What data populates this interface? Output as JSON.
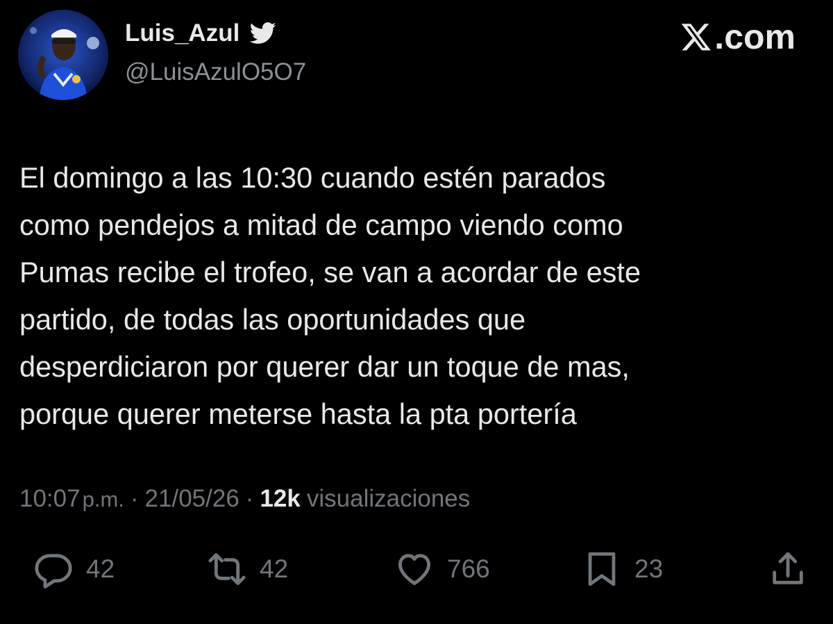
{
  "author": {
    "display_name": "Luis_Azul",
    "handle": "@LuisAzulO5O7",
    "verified_icon": "twitter-bird-icon",
    "avatar": "profile-photo-avatar"
  },
  "brand": {
    "label": ".com",
    "logo_icon": "x-logo-icon"
  },
  "tweet": {
    "lines": [
      "El domingo a las 10:30 cuando estén parados",
      "como pendejos a mitad de campo viendo como",
      "Pumas recibe el trofeo, se van a acordar de este",
      "partido, de todas las oportunidades que",
      "desperdiciaron por querer dar un toque de mas,",
      "porque querer meterse hasta la pta portería"
    ]
  },
  "meta": {
    "time": "10:07",
    "ampm": "p.m.",
    "separator": "·",
    "date": "21/05/26",
    "views_count": "12k",
    "views_label": "visualizaciones"
  },
  "actions": {
    "reply": {
      "icon": "reply-icon",
      "count": "42"
    },
    "repost": {
      "icon": "repost-icon",
      "count": "42"
    },
    "like": {
      "icon": "heart-icon",
      "count": "766"
    },
    "bookmark": {
      "icon": "bookmark-icon",
      "count": "23"
    },
    "share": {
      "icon": "share-icon"
    }
  },
  "colors": {
    "background": "#000000",
    "primary_text": "#e7e9ea",
    "secondary_text": "#71767b"
  }
}
